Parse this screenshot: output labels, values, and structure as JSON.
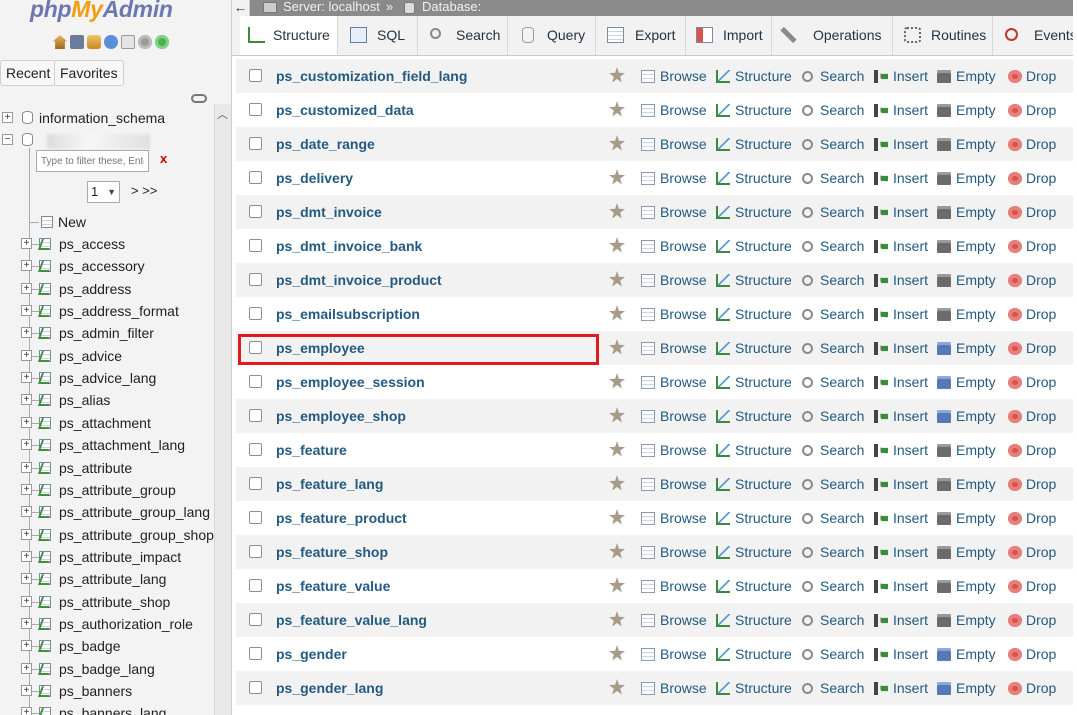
{
  "sidebar": {
    "logo_php": "php",
    "logo_my": "My",
    "logo_admin": "Admin",
    "recent_label": "Recent",
    "favorites_label": "Favorites",
    "filter_placeholder": "Type to filter these, Ente",
    "filter_clear": "x",
    "page_select_value": "1",
    "page_next": "> >>",
    "tree": {
      "information_schema": "information_schema",
      "new_label": "New",
      "tables": [
        "ps_access",
        "ps_accessory",
        "ps_address",
        "ps_address_format",
        "ps_admin_filter",
        "ps_advice",
        "ps_advice_lang",
        "ps_alias",
        "ps_attachment",
        "ps_attachment_lang",
        "ps_attribute",
        "ps_attribute_group",
        "ps_attribute_group_lang",
        "ps_attribute_group_shop",
        "ps_attribute_impact",
        "ps_attribute_lang",
        "ps_attribute_shop",
        "ps_authorization_role",
        "ps_badge",
        "ps_badge_lang",
        "ps_banners",
        "ps_banners_lang"
      ]
    }
  },
  "breadcrumb": {
    "server": "Server: localhost",
    "sep": "»",
    "database": "Database:"
  },
  "tabs": [
    "Structure",
    "SQL",
    "Search",
    "Query",
    "Export",
    "Import",
    "Operations",
    "Routines",
    "Events"
  ],
  "actions": {
    "browse": "Browse",
    "structure": "Structure",
    "search": "Search",
    "insert": "Insert",
    "empty": "Empty",
    "drop": "Drop"
  },
  "tables": [
    {
      "name": "ps_customization_field_lang",
      "empty_icon": "gray"
    },
    {
      "name": "ps_customized_data",
      "empty_icon": "gray"
    },
    {
      "name": "ps_date_range",
      "empty_icon": "gray"
    },
    {
      "name": "ps_delivery",
      "empty_icon": "gray"
    },
    {
      "name": "ps_dmt_invoice",
      "empty_icon": "gray"
    },
    {
      "name": "ps_dmt_invoice_bank",
      "empty_icon": "gray"
    },
    {
      "name": "ps_dmt_invoice_product",
      "empty_icon": "gray"
    },
    {
      "name": "ps_emailsubscription",
      "empty_icon": "gray"
    },
    {
      "name": "ps_employee",
      "empty_icon": "blue",
      "highlighted": true
    },
    {
      "name": "ps_employee_session",
      "empty_icon": "blue"
    },
    {
      "name": "ps_employee_shop",
      "empty_icon": "blue"
    },
    {
      "name": "ps_feature",
      "empty_icon": "gray"
    },
    {
      "name": "ps_feature_lang",
      "empty_icon": "gray"
    },
    {
      "name": "ps_feature_product",
      "empty_icon": "gray"
    },
    {
      "name": "ps_feature_shop",
      "empty_icon": "gray"
    },
    {
      "name": "ps_feature_value",
      "empty_icon": "gray"
    },
    {
      "name": "ps_feature_value_lang",
      "empty_icon": "gray"
    },
    {
      "name": "ps_gender",
      "empty_icon": "blue"
    },
    {
      "name": "ps_gender_lang",
      "empty_icon": "blue"
    }
  ],
  "colors": {
    "link": "#235a81",
    "highlight_border": "#e11b1b",
    "row_alt": "#f2f2f2"
  }
}
